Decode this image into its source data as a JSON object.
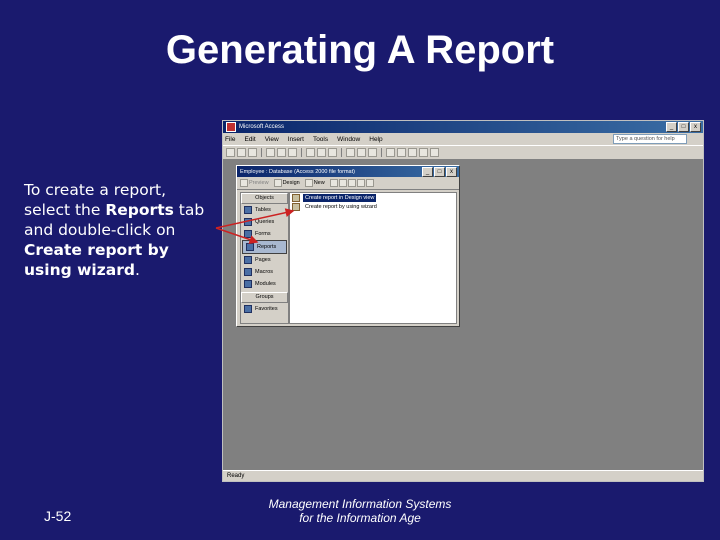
{
  "slide": {
    "title": "Generating A Report",
    "instructions": {
      "p1": "To create a report, select the ",
      "b1": "Reports",
      "p2": " tab and double-click on ",
      "b2": "Create report by using wizard",
      "p3": "."
    },
    "slide_number": "J-52",
    "footer_line1": "Management Information Systems",
    "footer_line2": "for the Information Age"
  },
  "app": {
    "title": "Microsoft Access",
    "menu": [
      "File",
      "Edit",
      "View",
      "Insert",
      "Tools",
      "Window",
      "Help"
    ],
    "help_placeholder": "Type a question for help",
    "status": "Ready",
    "window_buttons": [
      "_",
      "□",
      "x"
    ]
  },
  "dbwindow": {
    "title": "Employee : Database (Access 2000 file format)",
    "toolbar": {
      "preview": "Preview",
      "design": "Design",
      "new": "New"
    },
    "objects_header": "Objects",
    "objects": [
      "Tables",
      "Queries",
      "Forms",
      "Reports",
      "Pages",
      "Macros",
      "Modules"
    ],
    "selected_object": "Reports",
    "groups_header": "Groups",
    "favorites": "Favorites",
    "list_items": [
      "Create report in Design view",
      "Create report by using wizard"
    ]
  },
  "colors": {
    "background": "#1a1a6e",
    "arrow": "#cc2222",
    "titlebar": "#0a246a"
  }
}
